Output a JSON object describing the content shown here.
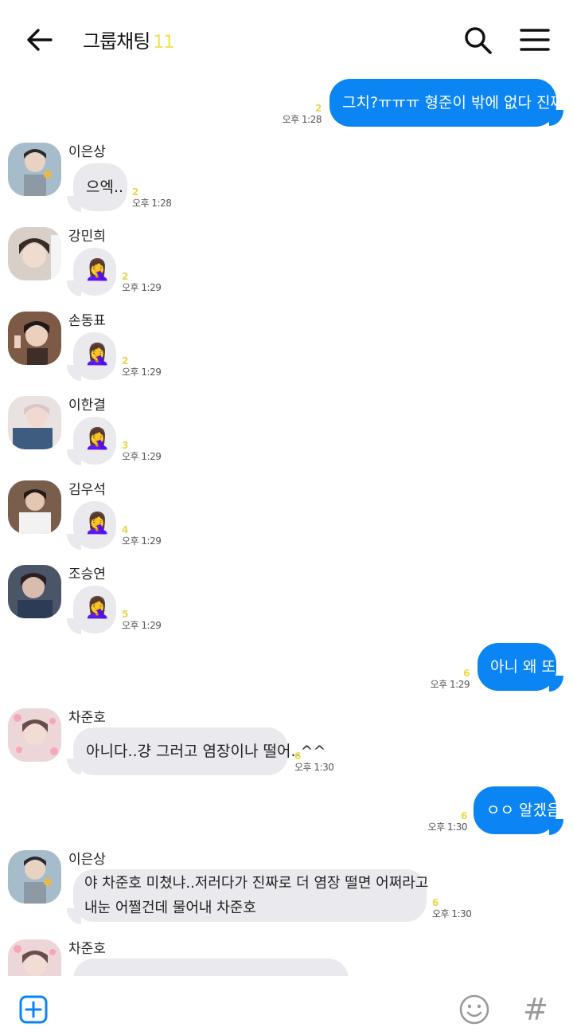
{
  "header": {
    "title": "그룹채팅",
    "member_count": "11",
    "back_icon": "arrow-left-icon",
    "search_icon": "search-icon",
    "menu_icon": "hamburger-menu-icon"
  },
  "colors": {
    "accent": "#0b84f4",
    "incoming_bubble": "#e9e9ee",
    "unread_count": "#e8d84a"
  },
  "messages": [
    {
      "direction": "out",
      "text": "그치?ㅠㅠㅠ 형준이 밖에 없다 진짜ㅠㅠㅠ",
      "unread": "2",
      "time": "오후 1:28"
    },
    {
      "direction": "in",
      "sender": "이은상",
      "text": "으엑..",
      "unread": "2",
      "time": "오후 1:28"
    },
    {
      "direction": "in",
      "sender": "강민희",
      "text": "🤦‍♀️",
      "unread": "2",
      "time": "오후 1:29"
    },
    {
      "direction": "in",
      "sender": "손동표",
      "text": "🤦‍♀️",
      "unread": "2",
      "time": "오후 1:29"
    },
    {
      "direction": "in",
      "sender": "이한결",
      "text": "🤦‍♀️",
      "unread": "3",
      "time": "오후 1:29"
    },
    {
      "direction": "in",
      "sender": "김우석",
      "text": "🤦‍♀️",
      "unread": "4",
      "time": "오후 1:29"
    },
    {
      "direction": "in",
      "sender": "조승연",
      "text": "🤦‍♀️",
      "unread": "5",
      "time": "오후 1:29"
    },
    {
      "direction": "out",
      "text": "아니 왜 또",
      "unread": "6",
      "time": "오후 1:29"
    },
    {
      "direction": "in",
      "sender": "차준호",
      "text": "아니다..걍 그러고 염장이나 떨어..^^",
      "unread": "6",
      "time": "오후 1:30"
    },
    {
      "direction": "out",
      "text": "ㅇㅇ 알겠음",
      "unread": "6",
      "time": "오후 1:30"
    },
    {
      "direction": "in",
      "sender": "이은상",
      "text_line1": "야 차준호 미쳤냐..저러다가 진짜로 더 염장 떨면 어쩌라고",
      "text_line2": "내눈 어쩔건데 물어내 차준호",
      "unread": "6",
      "time": "오후 1:30"
    },
    {
      "direction": "in",
      "sender": "차준호"
    }
  ],
  "bottom_bar": {
    "add_icon": "plus-square-icon",
    "emoji_icon": "smiley-icon",
    "hashtag_icon": "hashtag-icon",
    "hashtag_glyph": "#"
  }
}
